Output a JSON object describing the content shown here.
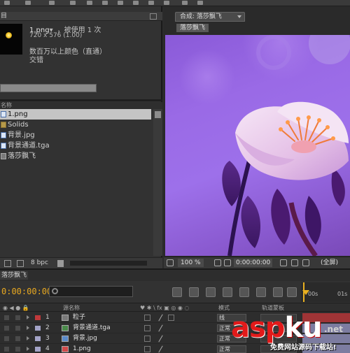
{
  "project_panel": {
    "tab_label": "目",
    "preview": {
      "file_name": "1.png",
      "used_text": "，被使用 1 次",
      "dimensions": "720 x 576 (1.00)",
      "color_info": "数百万以上颜色（直通）",
      "interpretation": "交错"
    },
    "column_header": "名称",
    "items": [
      {
        "label": "1.png",
        "icon": "image-file-icon",
        "selected": true
      },
      {
        "label": "Solids",
        "icon": "folder-icon",
        "selected": false
      },
      {
        "label": "背景.jpg",
        "icon": "image-file-icon",
        "selected": false
      },
      {
        "label": "背景通道.tga",
        "icon": "image-file-icon",
        "selected": false
      },
      {
        "label": "落莎飘飞",
        "icon": "composition-icon",
        "selected": false
      }
    ],
    "footer": {
      "bit_depth": "8 bpc"
    }
  },
  "composition_panel": {
    "tab_label": "合成: 落莎飘飞",
    "sub_tab_label": "落莎飘飞",
    "zoom": "100 %",
    "timecode": "0:00:00:00",
    "resolution": "(全屏)"
  },
  "timeline_panel": {
    "tab_label": "落莎飘飞",
    "current_time": "0:00:00:00",
    "ruler_labels": [
      "00s",
      "01s"
    ],
    "column_headers": {
      "source_name": "源名称",
      "mode": "模式",
      "parent": "轨道蒙板"
    },
    "layers": [
      {
        "num": "1",
        "name": "粒子",
        "mode": "线",
        "label_color": "#c0393b"
      },
      {
        "num": "2",
        "name": "背景通道.tga",
        "mode": "正常",
        "label_color": "#a3a3c7"
      },
      {
        "num": "3",
        "name": "背景.jpg",
        "mode": "正常",
        "label_color": "#a3a3c7"
      },
      {
        "num": "4",
        "name": "1.png",
        "mode": "正常",
        "label_color": "#a3a3c7"
      }
    ]
  },
  "watermark": {
    "brand_a": "asp",
    "brand_b": "ku",
    "brand_c": ".net",
    "tagline": "免费网站源码下载站!"
  }
}
